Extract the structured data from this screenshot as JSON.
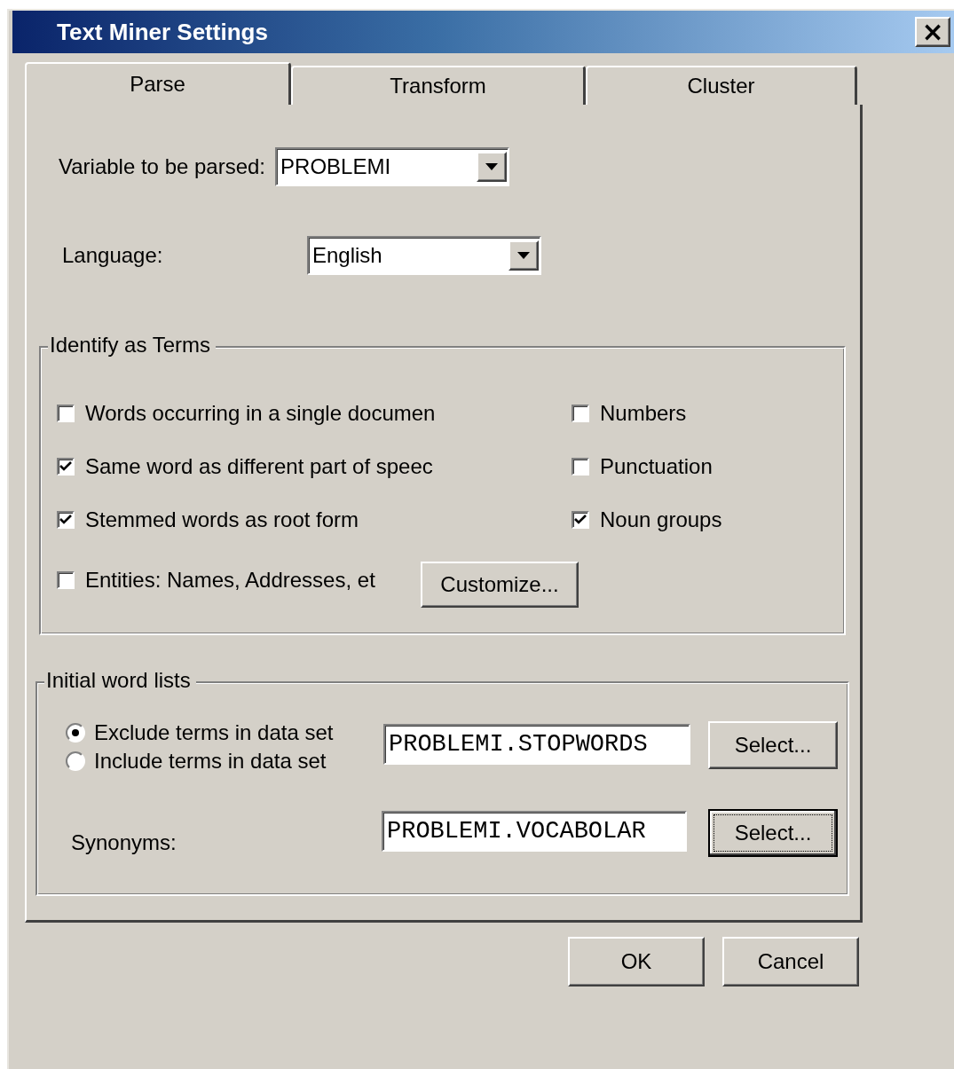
{
  "window": {
    "title": "Text Miner Settings",
    "close": "×"
  },
  "tabs": [
    {
      "label": "Parse",
      "selected": true
    },
    {
      "label": "Transform",
      "selected": false
    },
    {
      "label": "Cluster",
      "selected": false
    }
  ],
  "parse": {
    "variable": {
      "label": "Variable to be parsed:",
      "value": "PROBLEMI"
    },
    "language": {
      "label": "Language:",
      "value": "English"
    },
    "identify_terms": {
      "title": "Identify as Terms",
      "options": [
        {
          "label": "Words occurring in a single documen",
          "checked": false
        },
        {
          "label": "Numbers",
          "checked": false
        },
        {
          "label": "Same word as different part of speec",
          "checked": true
        },
        {
          "label": "Punctuation",
          "checked": false
        },
        {
          "label": "Stemmed words as root form",
          "checked": true
        },
        {
          "label": "Noun groups",
          "checked": true
        },
        {
          "label": "Entities: Names, Addresses, et",
          "checked": false,
          "button": "Customize..."
        }
      ]
    },
    "word_lists": {
      "title": "Initial word lists",
      "modes": [
        {
          "label": "Exclude terms in data set",
          "selected": true
        },
        {
          "label": "Include terms in data set",
          "selected": false
        }
      ],
      "list_value": "PROBLEMI.STOPWORDS",
      "list_button": {
        "label": "Select...",
        "focused": false
      },
      "synonyms_label": "Synonyms:",
      "synonyms_value": "PROBLEMI.VOCABOLAR",
      "synonyms_button": {
        "label": "Select...",
        "focused": true
      }
    }
  },
  "buttons": [
    {
      "label": "OK"
    },
    {
      "label": "Cancel"
    }
  ]
}
